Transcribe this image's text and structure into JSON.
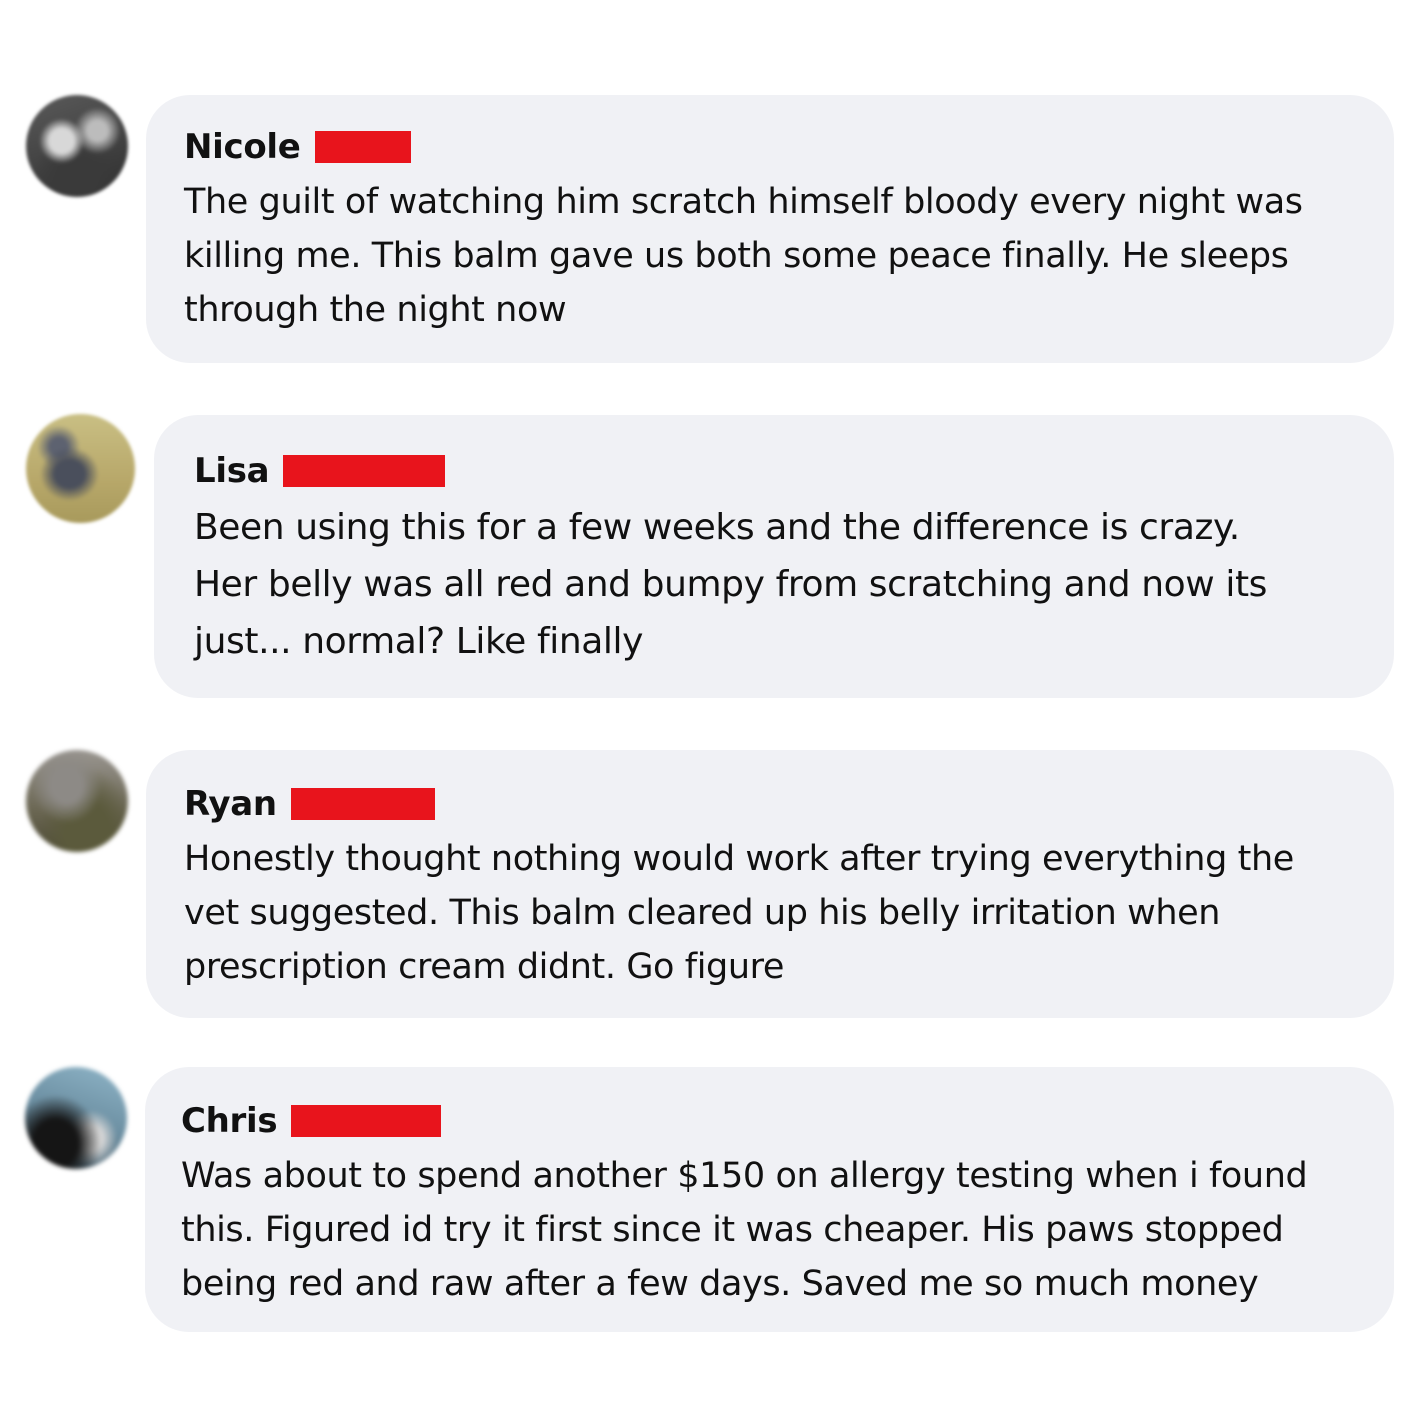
{
  "comments": [
    {
      "name": "Nicole",
      "avatar_icon": "user-avatar-photo",
      "lines": [
        "The guilt of watching him scratch himself bloody every night was",
        "killing me. This balm gave us both some peace finally. He sleeps",
        "through the night now"
      ]
    },
    {
      "name": "Lisa",
      "avatar_icon": "user-avatar-photo",
      "lines": [
        "Been using this for a few weeks and the difference is crazy.",
        "Her belly was all red and bumpy from scratching and now its",
        "just... normal? Like finally"
      ]
    },
    {
      "name": "Ryan",
      "avatar_icon": "user-avatar-photo",
      "lines": [
        "Honestly thought nothing would work after trying everything the",
        "vet suggested. This balm cleared up his belly irritation when",
        "prescription cream didnt. Go figure"
      ]
    },
    {
      "name": "Chris",
      "avatar_icon": "user-avatar-photo",
      "lines": [
        "Was about to spend another $150 on allergy testing when i found",
        "this. Figured id try it first since it was cheaper. His paws stopped",
        "being red and raw after a few days. Saved me so much money"
      ]
    }
  ],
  "colors": {
    "bubble": "#f0f1f5",
    "redaction": "#e8141c",
    "text": "#111111"
  }
}
